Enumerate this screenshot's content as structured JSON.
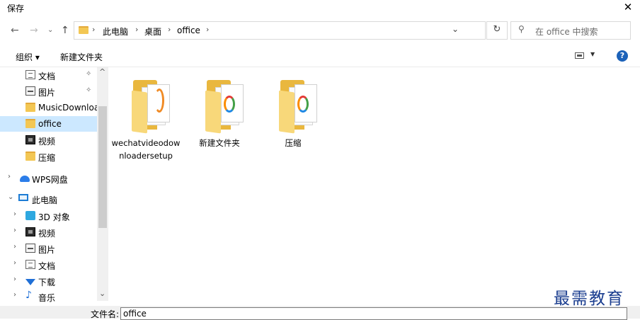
{
  "window": {
    "title": "保存",
    "close_glyph": "✕"
  },
  "address": {
    "crumbs": [
      "此电脑",
      "桌面",
      "office"
    ],
    "separator": "›",
    "dropdown_glyph": "⌄",
    "refresh_glyph": "↻"
  },
  "search": {
    "placeholder": "在 office 中搜索"
  },
  "toolbar": {
    "organize": "组织 ▾",
    "new_folder": "新建文件夹",
    "help": "?"
  },
  "nav": {
    "items": [
      {
        "label": "文档",
        "icon": "document-icon"
      },
      {
        "label": "图片",
        "icon": "picture-icon"
      },
      {
        "label": "MusicDownloa",
        "icon": "folder-icon"
      },
      {
        "label": "office",
        "icon": "folder-icon",
        "selected": true
      },
      {
        "label": "视频",
        "icon": "video-icon"
      },
      {
        "label": "压缩",
        "icon": "folder-icon"
      },
      {
        "label": "WPS网盘",
        "icon": "cloud-icon"
      },
      {
        "label": "此电脑",
        "icon": "computer-icon"
      },
      {
        "label": "3D 对象",
        "icon": "3d-objects-icon"
      },
      {
        "label": "视频",
        "icon": "video-icon"
      },
      {
        "label": "图片",
        "icon": "picture-icon"
      },
      {
        "label": "文档",
        "icon": "document-icon"
      },
      {
        "label": "下载",
        "icon": "download-icon"
      },
      {
        "label": "音乐",
        "icon": "music-icon"
      }
    ]
  },
  "files": [
    {
      "name": "wechatvideodownloadersetup",
      "icon": "folder-setup-icon"
    },
    {
      "name": "新建文件夹",
      "icon": "folder-icon"
    },
    {
      "name": "压缩",
      "icon": "folder-icon"
    }
  ],
  "filename": {
    "label": "文件名:",
    "value": "office"
  },
  "watermark": "最需教育"
}
